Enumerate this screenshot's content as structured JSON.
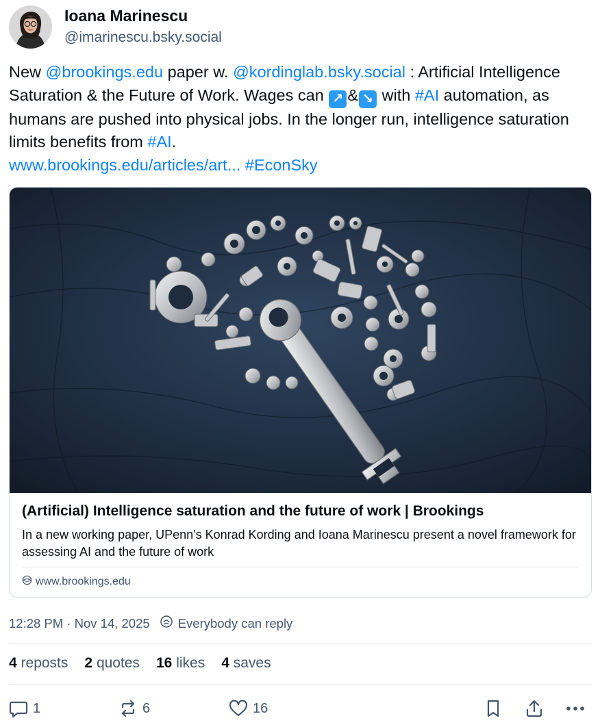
{
  "author": {
    "display_name": "Ioana Marinescu",
    "handle": "@imarinescu.bsky.social"
  },
  "post": {
    "t1": "New ",
    "mention1": "@brookings.edu",
    "t2": " paper w. ",
    "mention2": "@kordinglab.bsky.social",
    "t3": " : Artificial Intelligence Saturation & the Future of Work. Wages can ",
    "emoji_up": "↗",
    "t4": "&",
    "emoji_down": "↘",
    "t5": " with ",
    "tag_ai1": "#AI",
    "t6": " automation, as humans are pushed into physical jobs. In the longer run, intelligence saturation limits benefits from ",
    "tag_ai2": "#AI",
    "t7": ".",
    "link": "www.brookings.edu/articles/art...",
    "tag_econ": "#EconSky"
  },
  "card": {
    "title": "(Artificial) Intelligence saturation and the future of work | Brookings",
    "description": "In a new working paper, UPenn's Konrad Kording and Ioana Marinescu present a novel framework for assessing AI and the future of work",
    "domain": "www.brookings.edu",
    "image_icon": "brain-of-tools-image"
  },
  "meta": {
    "timestamp": "12:28 PM · Nov 14, 2025",
    "reply_setting": "Everybody can reply"
  },
  "stats": {
    "reposts_count": "4",
    "reposts_label": "reposts",
    "quotes_count": "2",
    "quotes_label": "quotes",
    "likes_count": "16",
    "likes_label": "likes",
    "saves_count": "4",
    "saves_label": "saves"
  },
  "actions": {
    "reply_count": "1",
    "repost_count": "6",
    "like_count": "16"
  },
  "colors": {
    "link": "#1083fe",
    "muted": "#42576c",
    "text": "#0b0f14",
    "border": "#d4dbe2"
  }
}
